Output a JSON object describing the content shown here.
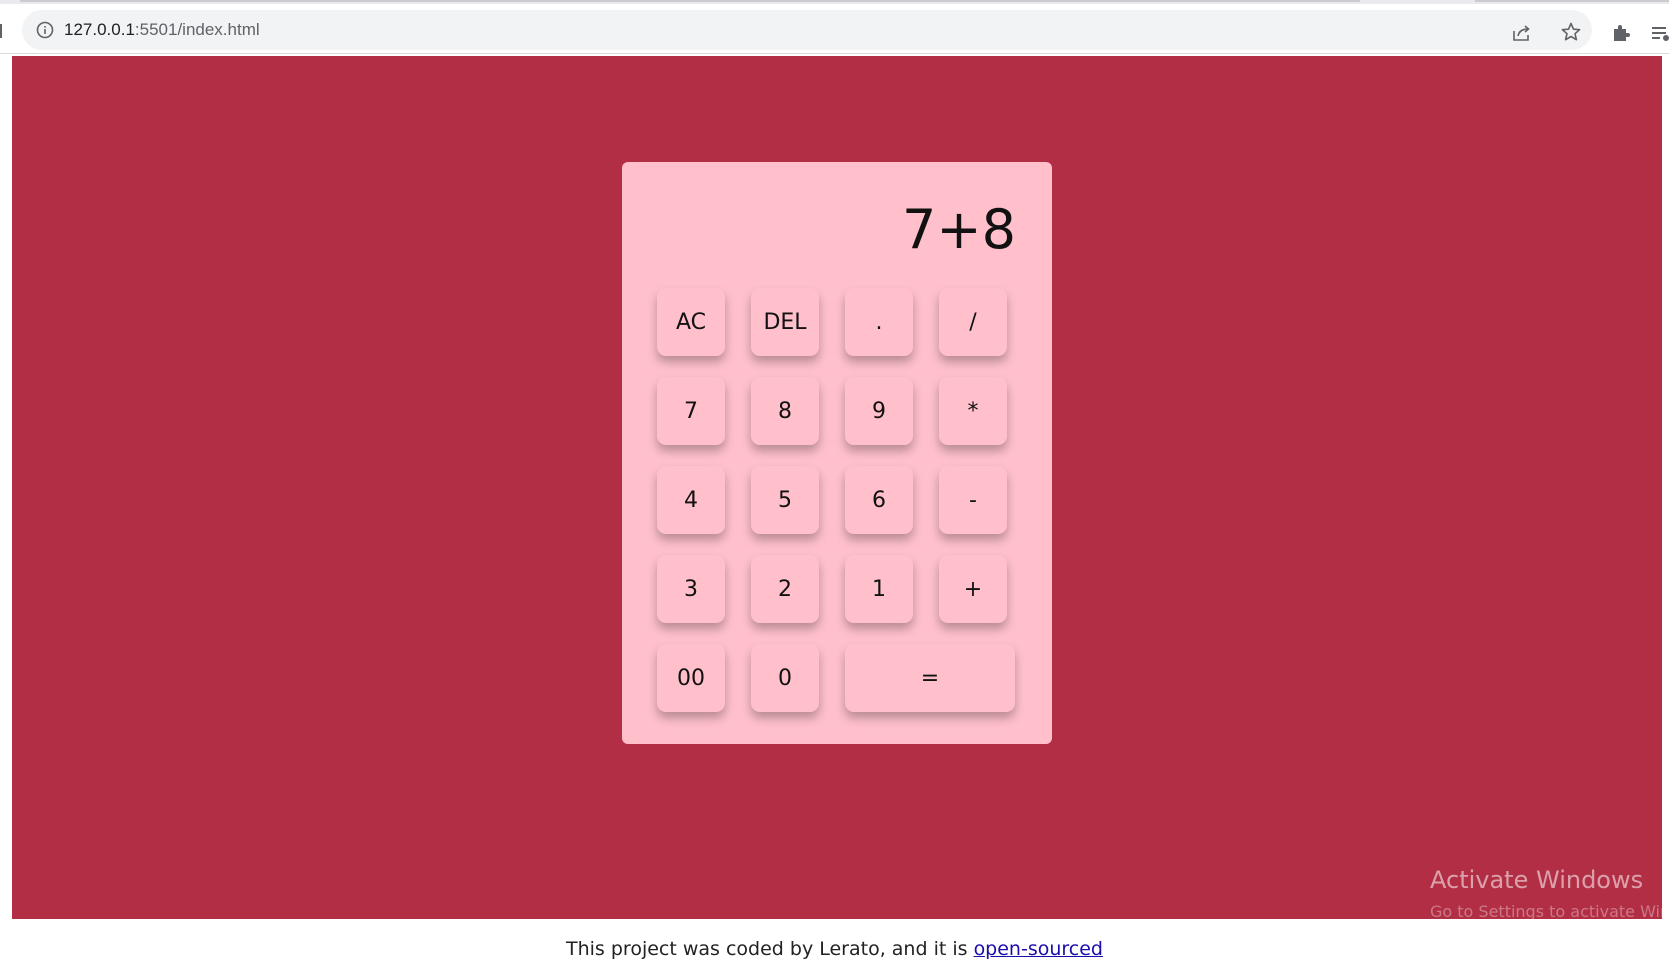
{
  "browser": {
    "url_host": "127.0.0.1",
    "url_rest": ":5501/index.html"
  },
  "calculator": {
    "display": "7+8",
    "rows": [
      [
        "AC",
        "DEL",
        ".",
        "/"
      ],
      [
        "7",
        "8",
        "9",
        "*"
      ],
      [
        "4",
        "5",
        "6",
        "-"
      ],
      [
        "3",
        "2",
        "1",
        "+"
      ],
      [
        "00",
        "0",
        "="
      ]
    ]
  },
  "watermark": {
    "title": "Activate Windows",
    "subtitle": "Go to Settings to activate Windows."
  },
  "footer": {
    "text": "This project was coded by Lerato, and it is ",
    "link_text": "open-sourced"
  },
  "colors": {
    "page_bg": "#b12e45",
    "calculator_bg": "#ffc0cb"
  }
}
